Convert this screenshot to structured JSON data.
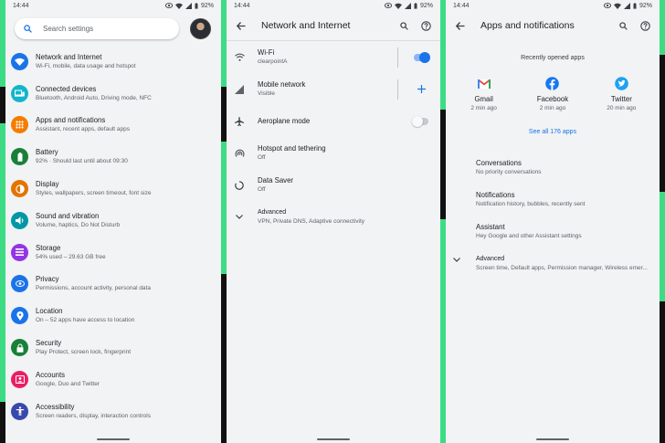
{
  "status_time": "14:44",
  "battery": "92%",
  "panel1": {
    "search_placeholder": "Search settings",
    "items": [
      {
        "title": "Network and Internet",
        "subtitle": "Wi-Fi, mobile, data usage and hotspot",
        "color": "#1a73e8",
        "icon": "wifi-icon"
      },
      {
        "title": "Connected devices",
        "subtitle": "Bluetooth, Android Auto, Driving mode, NFC",
        "color": "#12b5cb",
        "icon": "devices-icon"
      },
      {
        "title": "Apps and notifications",
        "subtitle": "Assistant, recent apps, default apps",
        "color": "#f57c00",
        "icon": "apps-icon"
      },
      {
        "title": "Battery",
        "subtitle": "92% · Should last until about 09:30",
        "color": "#188038",
        "icon": "battery-icon"
      },
      {
        "title": "Display",
        "subtitle": "Styles, wallpapers, screen timeout, font size",
        "color": "#e37400",
        "icon": "display-icon"
      },
      {
        "title": "Sound and vibration",
        "subtitle": "Volume, haptics, Do Not Disturb",
        "color": "#0097a7",
        "icon": "volume-icon"
      },
      {
        "title": "Storage",
        "subtitle": "54% used – 29.63 GB free",
        "color": "#9334e6",
        "icon": "storage-icon"
      },
      {
        "title": "Privacy",
        "subtitle": "Permissions, account activity, personal data",
        "color": "#1a73e8",
        "icon": "privacy-icon"
      },
      {
        "title": "Location",
        "subtitle": "On – 52 apps have access to location",
        "color": "#1a73e8",
        "icon": "location-icon"
      },
      {
        "title": "Security",
        "subtitle": "Play Protect, screen lock, fingerprint",
        "color": "#188038",
        "icon": "lock-icon"
      },
      {
        "title": "Accounts",
        "subtitle": "Google, Duo and Twitter",
        "color": "#e91e63",
        "icon": "accounts-icon"
      },
      {
        "title": "Accessibility",
        "subtitle": "Screen readers, display, interaction controls",
        "color": "#3949ab",
        "icon": "accessibility-icon"
      }
    ]
  },
  "panel2": {
    "title": "Network and Internet",
    "items": [
      {
        "title": "Wi-Fi",
        "subtitle": "clearpointA",
        "icon": "wifi-icon",
        "toggle": "on"
      },
      {
        "title": "Mobile network",
        "subtitle": "Visible",
        "icon": "signal-icon"
      },
      {
        "title": "Aeroplane mode",
        "subtitle": "",
        "icon": "airplane-icon",
        "toggle": "off"
      },
      {
        "title": "Hotspot and tethering",
        "subtitle": "Off",
        "icon": "hotspot-icon"
      },
      {
        "title": "Data Saver",
        "subtitle": "Off",
        "icon": "data-saver-icon"
      },
      {
        "title": "Advanced",
        "subtitle": "VPN, Private DNS, Adaptive connectivity",
        "icon": "chevron-down-icon"
      }
    ]
  },
  "panel3": {
    "title": "Apps and notifications",
    "recent_header": "Recently opened apps",
    "apps": [
      {
        "name": "Gmail",
        "time": "2 min ago",
        "icon": "gmail-icon"
      },
      {
        "name": "Facebook",
        "time": "2 min ago",
        "icon": "facebook-icon"
      },
      {
        "name": "Twitter",
        "time": "20 min ago",
        "icon": "twitter-icon"
      }
    ],
    "see_all": "See all 176 apps",
    "options": [
      {
        "title": "Conversations",
        "subtitle": "No priority conversations"
      },
      {
        "title": "Notifications",
        "subtitle": "Notification history, bubbles, recently sent"
      },
      {
        "title": "Assistant",
        "subtitle": "Hey Google and other Assistant settings"
      },
      {
        "title": "Advanced",
        "subtitle": "Screen time, Default apps, Permission manager, Wireless emer..."
      }
    ]
  }
}
